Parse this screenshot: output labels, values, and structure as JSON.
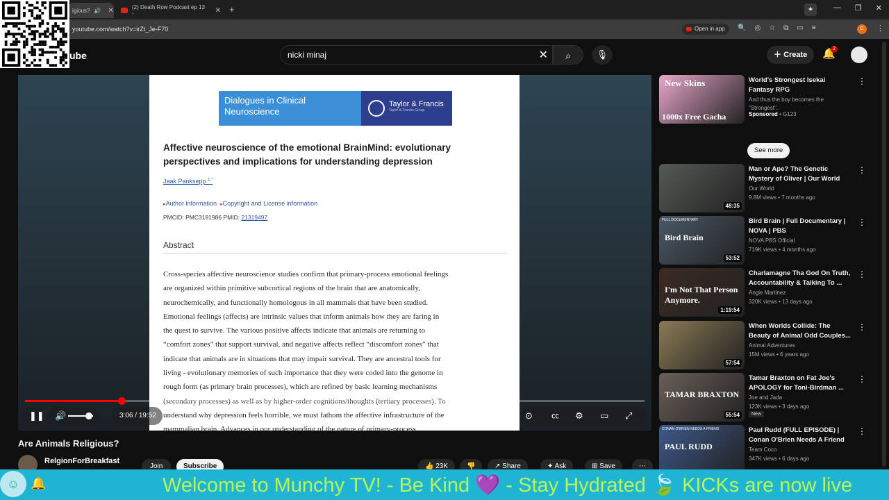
{
  "browser": {
    "tabs": [
      {
        "label": "igious?",
        "active": true
      },
      {
        "label": "(2) Death Row Podcast ep 13 -",
        "active": false
      }
    ],
    "url": "youtube.com/watch?v=irZt_Je-F70",
    "open_in_app": "Open in app",
    "profile_initial": "C"
  },
  "yt": {
    "logo_partial": "ube",
    "search_value": "nicki minaj",
    "create_label": "Create",
    "notif_count": "2"
  },
  "paper": {
    "journal": "Dialogues in Clinical Neuroscience",
    "publisher": "Taylor & Francis",
    "publisher_sub": "Taylor & Francis Group",
    "title": "Affective neuroscience of the emotional BrainMind: evolutionary perspectives and implications for understanding depression",
    "author": "Jaak Panksepp",
    "author_sup": "1,*",
    "author_info": "Author information",
    "copyright": "Copyright and License information",
    "ids_prefix": "PMCID: PMC3181986  PMID: ",
    "pmid": "21319497",
    "abstract_heading": "Abstract",
    "abstract_lines": [
      "Cross-species affective neuroscience studies confirm that primary-process emotional feelings",
      "are organized within primitive subcortical regions of the brain that are anatomically,",
      "neurochemically, and functionally homologous in all mammals that have been studied.",
      "Emotional feelings (affects) are intrinsic values that inform animals how they are faring in",
      "the quest to survive. The various positive affects indicate that animals are returning to",
      "“comfort zones” that support survival, and negative affects reflect “discomfort zones” that",
      "indicate that animals are in situations that may impair survival. They are ancestral tools for",
      "living - evolutionary memories of such importance that they were coded into the genome in",
      "rough form (as primary brain processes), which are refined by basic learning mechanisms",
      "(secondary processes) as well as by higher-order cognitions/thoughts (tertiary processes). To",
      "understand why depression feels horrible, we must fathom the affective infrastructure of the",
      "mammalian brain. Advances in our understanding of the nature of primary-process"
    ]
  },
  "player": {
    "time_current": "3:06",
    "time_sep": " / ",
    "time_total": "19:52",
    "progress_fraction": 0.156
  },
  "video": {
    "title": "Are Animals Religious?",
    "channel": "RelgionForBreakfast",
    "join": "Join",
    "subscribe": "Subscribe",
    "likes": "23K",
    "share": "Share",
    "ask": "Ask",
    "save": "Save"
  },
  "sidebar": {
    "see_more": "See more",
    "items": [
      {
        "title": "World's Strongest Isekai Fantasy RPG",
        "channel": "And thus the boy becomes the \"Strongest\".",
        "meta": "G123",
        "sponsored": "Sponsored",
        "duration": "",
        "thumb_color": "#e9a6c9",
        "thumb_text": "New Skins",
        "thumb_text2": "1000x Free Gacha"
      },
      {
        "title": "Man or Ape? The Genetic Mystery of Oliver | Our World",
        "channel": "Our World",
        "meta": "9.8M views • 7 months ago",
        "duration": "48:35",
        "thumb_color": "#555a55"
      },
      {
        "title": "Bird Brain | Full Documentary | NOVA | PBS",
        "channel": "NOVA PBS Official",
        "meta": "719K views • 4 months ago",
        "duration": "53:52",
        "thumb_color": "#4a5866",
        "thumb_text": "Bird Brain",
        "thumb_tag": "FULL DOCUMENTARY"
      },
      {
        "title": "Charlamagne Tha God On Truth, Accountability & Talking To ...",
        "channel": "Angie Martinez",
        "meta": "320K views • 13 days ago",
        "duration": "1:19:54",
        "thumb_color": "#3b2a22",
        "thumb_text": "I'm Not That Person Anymore."
      },
      {
        "title": "When Worlds Collide: The Beauty of Animal Odd Couples...",
        "channel": "Animal Adventures",
        "meta": "15M views • 6 years ago",
        "duration": "57:54",
        "thumb_color": "#8a7a55"
      },
      {
        "title": "Tamar Braxton on Fat Joe's APOLOGY for Toni-Birdman ...",
        "channel": "Joe and Jada",
        "meta": "123K views • 3 days ago",
        "duration": "55:54",
        "thumb_color": "#6a5f58",
        "thumb_text": "TAMAR BRAXTON",
        "badge": "New"
      },
      {
        "title": "Paul Rudd (FULL EPISODE) | Conan O'Brien Needs A Friend",
        "channel": "Team Coco",
        "meta": "347K views • 6 days ago",
        "duration": "",
        "thumb_color": "#3d5a8a",
        "thumb_text": "PAUL RUDD",
        "thumb_tag": "CONAN O'BRIEN NEEDS A FRIEND"
      }
    ]
  },
  "ticker": {
    "text": "Welcome to Munchy TV!  - Be Kind 💜  - Stay Hydrated 🍃  KICKs are now live"
  }
}
